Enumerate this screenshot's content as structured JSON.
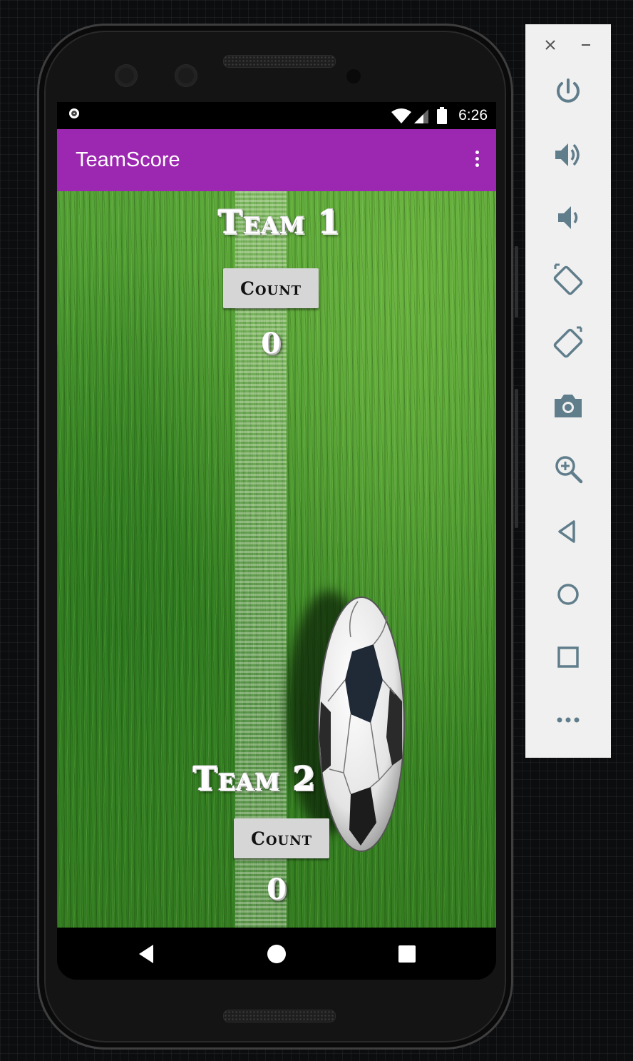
{
  "status_bar": {
    "time": "6:26"
  },
  "app_bar": {
    "title": "TeamScore"
  },
  "teams": [
    {
      "title": "Team 1",
      "button_label": "Count",
      "score": "0"
    },
    {
      "title": "Team 2",
      "button_label": "Count",
      "score": "0"
    }
  ],
  "navigation": [
    "back-icon",
    "home-icon",
    "recents-icon"
  ],
  "emulator_panel": {
    "window_controls": [
      "close-icon",
      "minimize-icon"
    ],
    "buttons": [
      "power-icon",
      "volume-up-icon",
      "volume-down-icon",
      "rotate-left-icon",
      "rotate-right-icon",
      "camera-icon",
      "zoom-icon",
      "back-icon",
      "home-icon",
      "overview-icon",
      "more-icon"
    ]
  },
  "colors": {
    "app_bar": "#9c27b0",
    "field": "#3f8f2a",
    "button": "#d6d6d6",
    "panel": "#f0f0f0"
  }
}
